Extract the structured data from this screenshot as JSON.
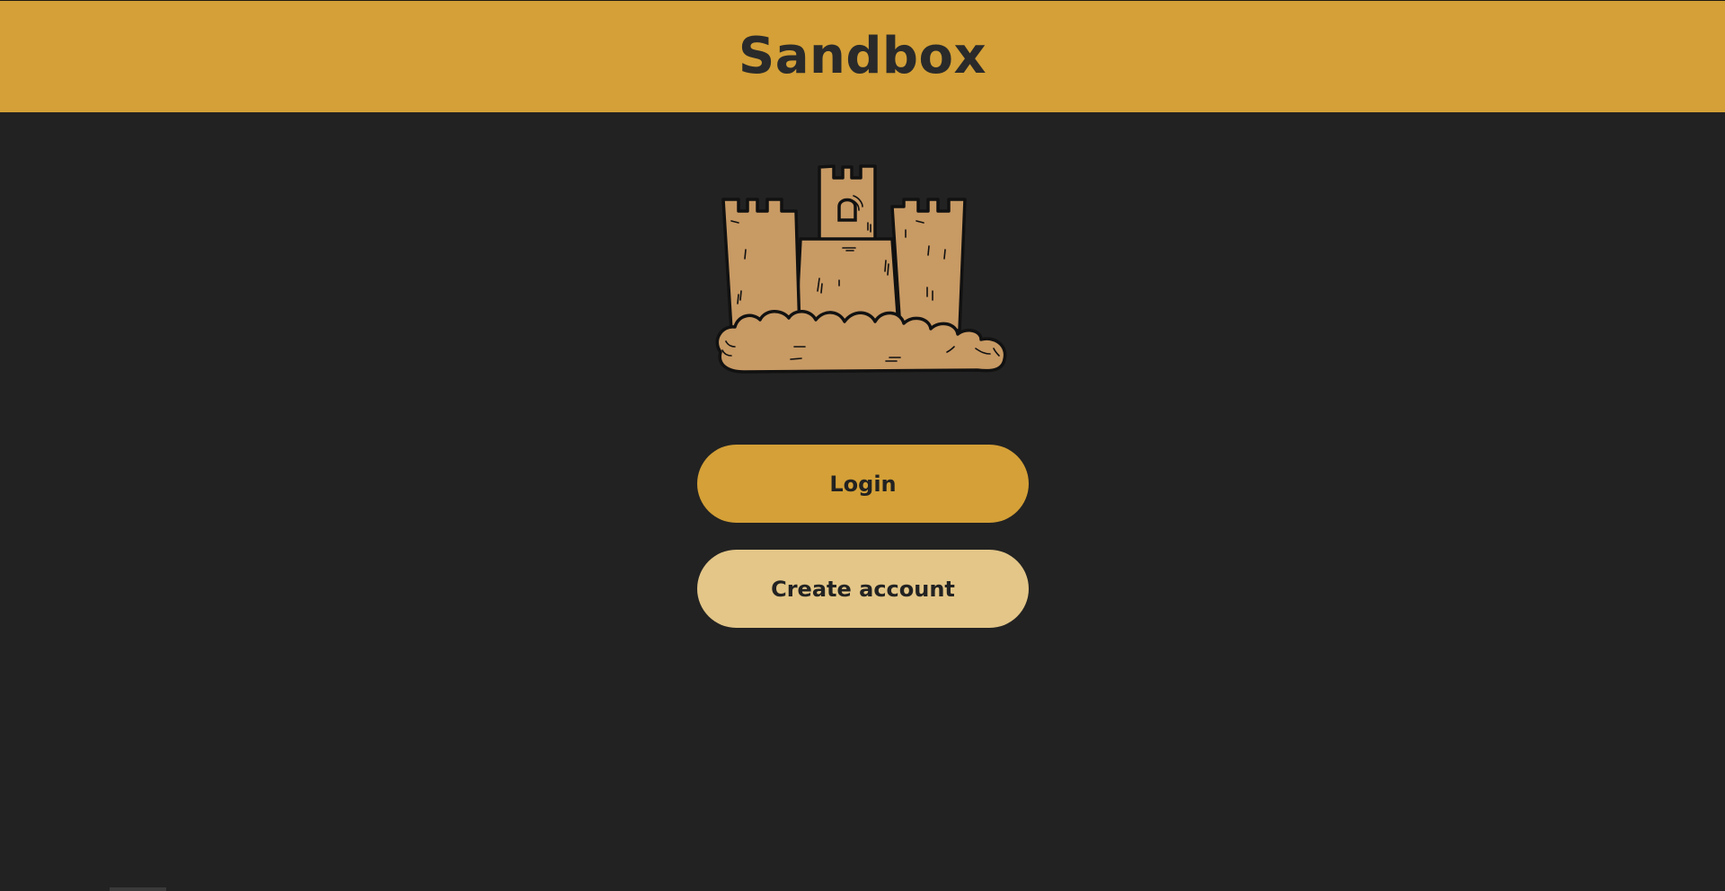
{
  "app": {
    "title": "Sandbox"
  },
  "logo": {
    "icon": "sandcastle-icon"
  },
  "actions": {
    "login_label": "Login",
    "create_account_label": "Create account"
  },
  "colors": {
    "header_bg": "#d4a037",
    "page_bg": "#222222",
    "primary_button": "#d4a037",
    "secondary_button": "#e3c688",
    "sand": "#c89a64",
    "outline": "#111111"
  }
}
